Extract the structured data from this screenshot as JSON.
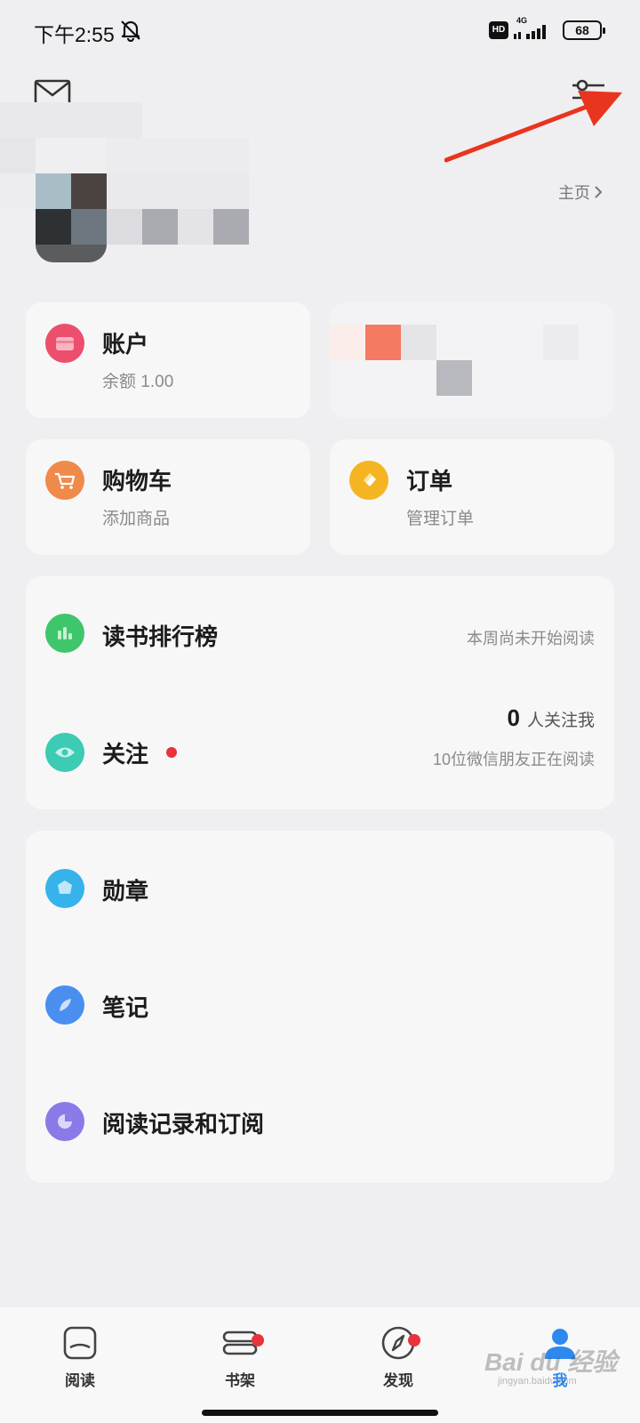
{
  "status_bar": {
    "time": "下午2:55",
    "network": "4G",
    "hd": "HD",
    "battery": "68"
  },
  "header": {
    "homepage_link": "主页"
  },
  "cards": {
    "account": {
      "title": "账户",
      "subtitle": "余额 1.00",
      "icon": "wallet-icon",
      "color": "#ec4f6c"
    },
    "cart": {
      "title": "购物车",
      "subtitle": "添加商品",
      "icon": "cart-icon",
      "color": "#f08a4b"
    },
    "orders": {
      "title": "订单",
      "subtitle": "管理订单",
      "icon": "orders-icon",
      "color": "#f5b522"
    }
  },
  "reading_section": {
    "ranking": {
      "label": "读书排行榜",
      "status": "本周尚未开始阅读",
      "icon": "chart-icon",
      "color": "#3fc66a"
    },
    "follow": {
      "label": "关注",
      "count": "0",
      "count_suffix": "人关注我",
      "friends_note": "10位微信朋友正在阅读",
      "icon": "eye-icon",
      "color": "#3ccbb3"
    }
  },
  "menu": {
    "medals": {
      "label": "勋章",
      "icon": "medal-icon",
      "color": "#36b3ea"
    },
    "notes": {
      "label": "笔记",
      "icon": "feather-icon",
      "color": "#4a8ff0"
    },
    "history": {
      "label": "阅读记录和订阅",
      "icon": "history-icon",
      "color": "#8a7ae8"
    }
  },
  "bottom_nav": {
    "items": [
      {
        "label": "阅读",
        "icon": "book-icon",
        "badge": false
      },
      {
        "label": "书架",
        "icon": "shelf-icon",
        "badge": true
      },
      {
        "label": "发现",
        "icon": "compass-icon",
        "badge": true
      },
      {
        "label": "我",
        "icon": "profile-icon",
        "badge": false,
        "active": true
      }
    ]
  },
  "colors": {
    "background": "#efeff1",
    "card": "#f7f7f8",
    "badge_red": "#e8333c",
    "active_blue": "#2f88f0",
    "annotation_red": "#e8351e"
  },
  "watermark": {
    "text": "Bai du 经验",
    "sub": "jingyan.baidu.com"
  }
}
